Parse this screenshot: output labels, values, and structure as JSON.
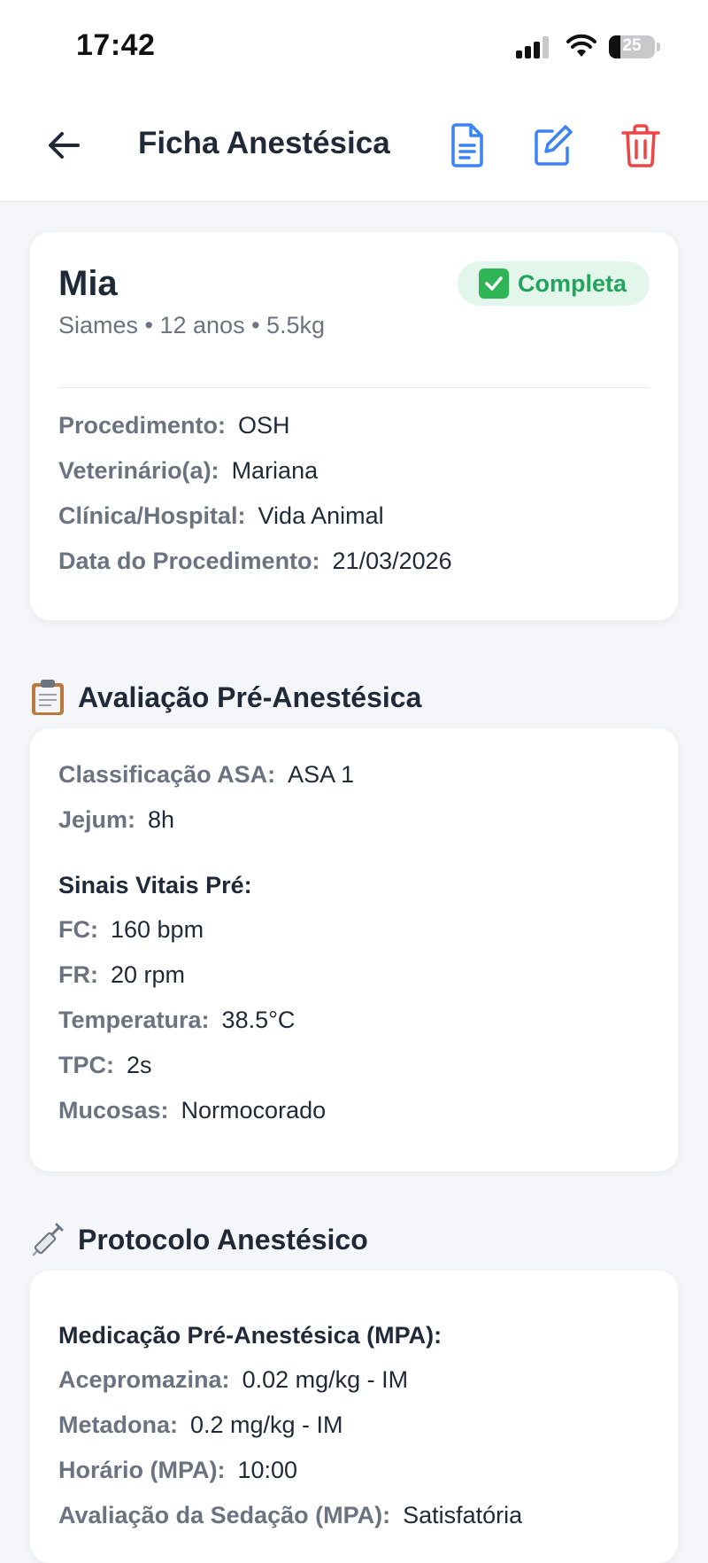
{
  "status_bar": {
    "time": "17:42",
    "battery_level": "25"
  },
  "nav": {
    "title": "Ficha Anestésica"
  },
  "patient": {
    "name": "Mia",
    "status_badge": "Completa",
    "subtitle": "Siames • 12 anos • 5.5kg",
    "details": [
      {
        "label": "Procedimento:",
        "value": "OSH"
      },
      {
        "label": "Veterinário(a):",
        "value": "Mariana"
      },
      {
        "label": "Clínica/Hospital:",
        "value": "Vida Animal"
      },
      {
        "label": "Data do Procedimento:",
        "value": "21/03/2026"
      }
    ]
  },
  "pre_evaluation": {
    "title": "Avaliação Pré-Anestésica",
    "rows": [
      {
        "label": "Classificação ASA:",
        "value": "ASA 1"
      },
      {
        "label": "Jejum:",
        "value": "8h"
      }
    ],
    "vitals_heading": "Sinais Vitais Pré:",
    "vitals": [
      {
        "label": "FC:",
        "value": "160 bpm"
      },
      {
        "label": "FR:",
        "value": "20 rpm"
      },
      {
        "label": "Temperatura:",
        "value": "38.5°C"
      },
      {
        "label": "TPC:",
        "value": "2s"
      },
      {
        "label": "Mucosas:",
        "value": "Normocorado"
      }
    ]
  },
  "protocol": {
    "title": "Protocolo Anestésico",
    "mpa_heading": "Medicação Pré-Anestésica (MPA):",
    "rows": [
      {
        "label": "Acepromazina:",
        "value": "0.02 mg/kg - IM"
      },
      {
        "label": "Metadona:",
        "value": "0.2 mg/kg - IM"
      },
      {
        "label": "Horário (MPA):",
        "value": "10:00"
      },
      {
        "label": "Avaliação da Sedação (MPA):",
        "value": "Satisfatória"
      }
    ]
  },
  "colors": {
    "accent_blue": "#3b82f6",
    "danger_red": "#ef4444",
    "success_green": "#22a45d",
    "badge_bg": "#e3f6ec",
    "label_gray": "#6b7280",
    "page_bg": "#f4f6f9"
  },
  "icons": {
    "back": "arrow-left-icon",
    "document": "document-icon",
    "edit": "edit-icon",
    "delete": "trash-icon",
    "status": "check-box-icon",
    "pre_section": "clipboard-icon",
    "protocol_section": "syringe-icon",
    "signal": "cellular-signal-icon",
    "wifi": "wifi-icon",
    "battery": "battery-icon"
  }
}
